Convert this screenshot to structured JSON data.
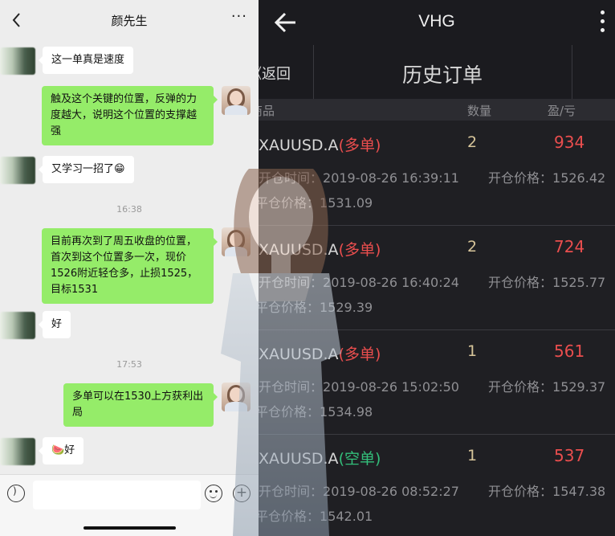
{
  "chat": {
    "contact_name": "颜先生",
    "more_label": "···",
    "messages": [
      {
        "side": "left",
        "text": "这一单真是速度"
      },
      {
        "side": "right",
        "text": "触及这个关键的位置，反弹的力度越大，说明这个位置的支撑越强"
      },
      {
        "side": "left",
        "text": "又学习一招了😁"
      },
      {
        "side": "right",
        "text": "目前再次到了周五收盘的位置，首次到这个位置多一次，现价1526附近轻仓多，止损1525，目标1531"
      },
      {
        "side": "left",
        "text": "好"
      },
      {
        "side": "right",
        "text": "多单可以在1530上方获利出局"
      },
      {
        "side": "left",
        "text": "🍉好"
      }
    ],
    "timestamps": [
      "16:38",
      "17:53"
    ],
    "input_placeholder": "",
    "colors": {
      "own_bubble": "#95ec69",
      "other_bubble": "#ffffff",
      "background": "#ededed"
    }
  },
  "trade": {
    "app_title": "VHG",
    "back_label": "《返回",
    "page_title": "历史订单",
    "columns": {
      "product": "商品",
      "quantity": "数量",
      "pnl": "盈/亏"
    },
    "open_time_label": "开仓时间：",
    "open_price_label": "开仓价格：",
    "close_price_label": "平仓价格：",
    "orders": [
      {
        "symbol": "XAUUSD.A",
        "direction": "(多单)",
        "direction_type": "buy",
        "quantity": "2",
        "pnl": "934",
        "open_time": "2019-08-26 16:39:11",
        "open_price": "1526.42",
        "close_price": "1531.09"
      },
      {
        "symbol": "XAUUSD.A",
        "direction": "(多单)",
        "direction_type": "buy",
        "quantity": "2",
        "pnl": "724",
        "open_time": "2019-08-26 16:40:24",
        "open_price": "1525.77",
        "close_price": "1529.39"
      },
      {
        "symbol": "XAUUSD.A",
        "direction": "(多单)",
        "direction_type": "buy",
        "quantity": "1",
        "pnl": "561",
        "open_time": "2019-08-26 15:02:50",
        "open_price": "1529.37",
        "close_price": "1534.98"
      },
      {
        "symbol": "XAUUSD.A",
        "direction": "(空单)",
        "direction_type": "sell",
        "quantity": "1",
        "pnl": "537",
        "open_time": "2019-08-26 08:52:27",
        "open_price": "1547.38",
        "close_price": "1542.01"
      }
    ],
    "colors": {
      "profit": "#ea4e4e",
      "buy": "#ea4e4e",
      "sell": "#33bf7a",
      "quantity": "#d7c59a",
      "background": "#1f1f23"
    }
  }
}
